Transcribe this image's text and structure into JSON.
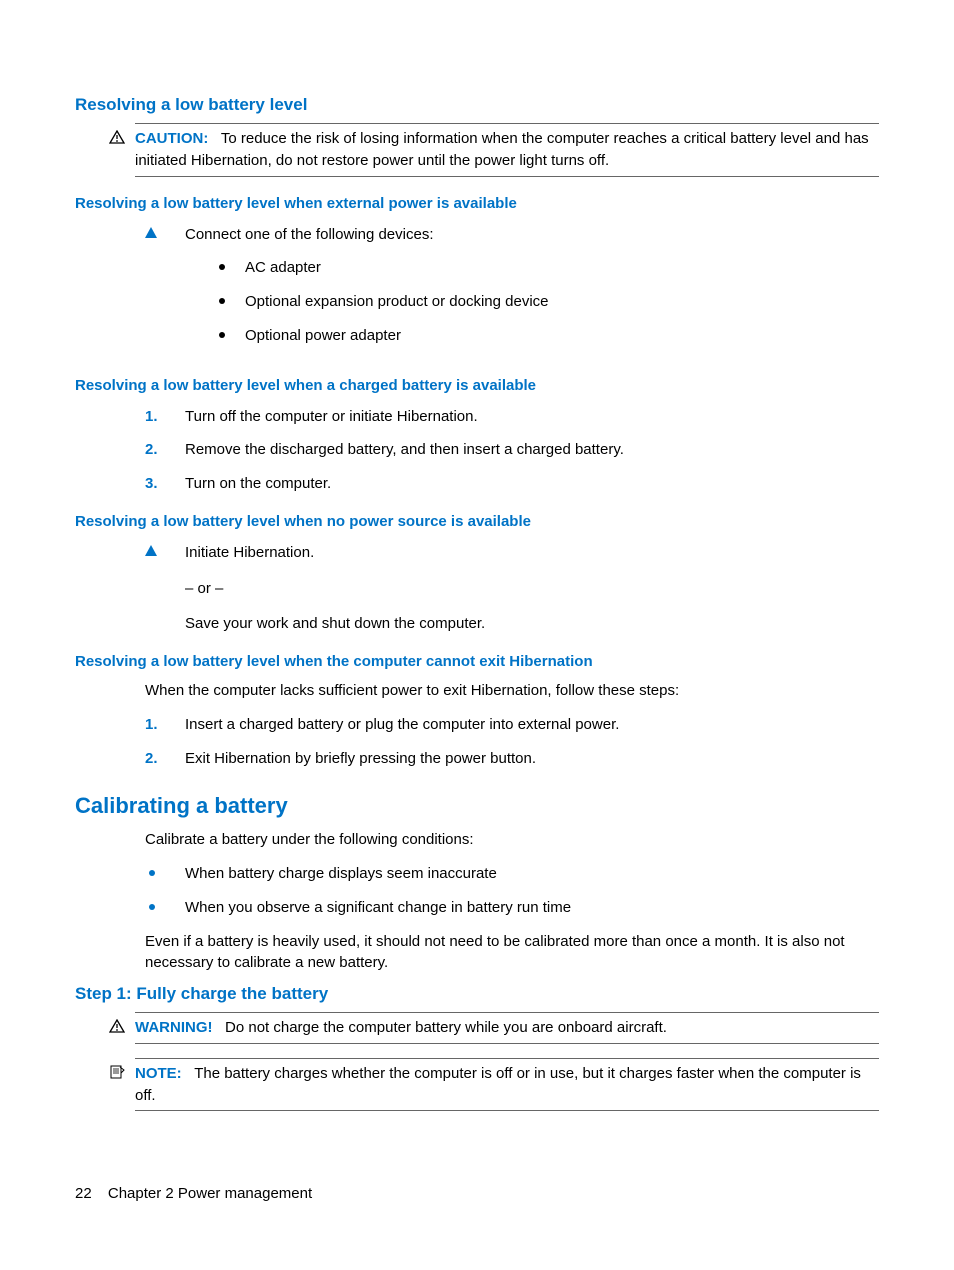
{
  "section1": {
    "title": "Resolving a low battery level",
    "caution_label": "CAUTION:",
    "caution_text": "To reduce the risk of losing information when the computer reaches a critical battery level and has initiated Hibernation, do not restore power until the power light turns off.",
    "sub1": {
      "title": "Resolving a low battery level when external power is available",
      "lead": "Connect one of the following devices:",
      "items": [
        "AC adapter",
        "Optional expansion product or docking device",
        "Optional power adapter"
      ]
    },
    "sub2": {
      "title": "Resolving a low battery level when a charged battery is available",
      "steps": [
        "Turn off the computer or initiate Hibernation.",
        "Remove the discharged battery, and then insert a charged battery.",
        "Turn on the computer."
      ]
    },
    "sub3": {
      "title": "Resolving a low battery level when no power source is available",
      "lead": "Initiate Hibernation.",
      "or": "– or –",
      "alt": "Save your work and shut down the computer."
    },
    "sub4": {
      "title": "Resolving a low battery level when the computer cannot exit Hibernation",
      "lead": "When the computer lacks sufficient power to exit Hibernation, follow these steps:",
      "steps": [
        "Insert a charged battery or plug the computer into external power.",
        "Exit Hibernation by briefly pressing the power button."
      ]
    }
  },
  "section2": {
    "title": "Calibrating a battery",
    "lead": "Calibrate a battery under the following conditions:",
    "items": [
      "When battery charge displays seem inaccurate",
      "When you observe a significant change in battery run time"
    ],
    "tail": "Even if a battery is heavily used, it should not need to be calibrated more than once a month. It is also not necessary to calibrate a new battery.",
    "step1": {
      "title": "Step 1: Fully charge the battery",
      "warning_label": "WARNING!",
      "warning_text": "Do not charge the computer battery while you are onboard aircraft.",
      "note_label": "NOTE:",
      "note_text": "The battery charges whether the computer is off or in use, but it charges faster when the computer is off."
    }
  },
  "footer": {
    "page": "22",
    "chapter": "Chapter 2   Power management"
  }
}
